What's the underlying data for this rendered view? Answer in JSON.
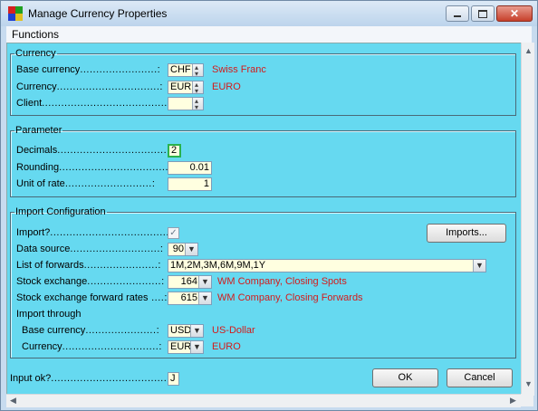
{
  "window": {
    "title": "Manage Currency Properties",
    "menu": [
      "Functions"
    ]
  },
  "currency_group": {
    "legend": "Currency",
    "base_currency": {
      "label": "Base currency",
      "code": "CHF",
      "name": "Swiss Franc"
    },
    "currency": {
      "label": "Currency",
      "code": "EUR",
      "name": "EURO"
    },
    "client": {
      "label": "Client",
      "value": ""
    }
  },
  "parameter_group": {
    "legend": "Parameter",
    "decimals": {
      "label": "Decimals",
      "value": "2"
    },
    "rounding": {
      "label": "Rounding",
      "value": "0.01"
    },
    "unit_of_rate": {
      "label": "Unit of rate",
      "value": "1"
    }
  },
  "import_group": {
    "legend": "Import Configuration",
    "import": {
      "label": "Import?",
      "checked": true,
      "check_glyph": "✓"
    },
    "imports_button": "Imports...",
    "data_source": {
      "label": "Data source",
      "value": "90"
    },
    "list_of_forwards": {
      "label": "List of forwards",
      "value": "1M,2M,3M,6M,9M,1Y"
    },
    "stock_exchange": {
      "label": "Stock exchange",
      "value": "164",
      "name": "WM Company, Closing Spots"
    },
    "stock_exchange_forward": {
      "label": "Stock exchange forward rates",
      "value": "615",
      "name": "WM Company, Closing Forwards"
    },
    "import_through_label": "Import through",
    "through_base_currency": {
      "label": "Base currency",
      "value": "USD",
      "name": "US-Dollar"
    },
    "through_currency": {
      "label": "Currency",
      "value": "EUR",
      "name": "EURO"
    }
  },
  "footer": {
    "input_ok": {
      "label": "Input ok?",
      "value": "J"
    },
    "ok_button": "OK",
    "cancel_button": "Cancel"
  },
  "colors": {
    "client_bg": "#66d9f0",
    "label_red": "#d41b1b",
    "field_yellow": "#ffffe0"
  }
}
